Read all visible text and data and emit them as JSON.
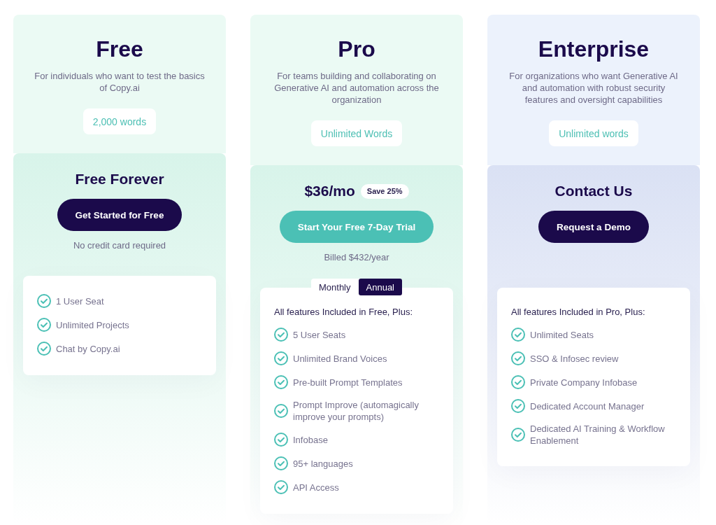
{
  "plans": [
    {
      "name": "Free",
      "description": "For individuals who want to test the basics of Copy.ai",
      "color": "#ebfaf4",
      "word_limit": "2,000 words",
      "offer": {
        "color": "#d8f4ea",
        "headline": "Free Forever",
        "cta": {
          "label": "Get Started for Free",
          "kind": "dark"
        },
        "note": "No credit card required"
      },
      "features": {
        "items": [
          "1 User Seat",
          "Unlimited Projects",
          "Chat by Copy.ai"
        ]
      }
    },
    {
      "name": "Pro",
      "description": "For teams building and collaborating on Generative AI and automation across the organization",
      "color": "#ebfaf4",
      "word_limit": "Unlimited Words",
      "offer": {
        "color": "#d8f4ea",
        "headline": "$36/mo",
        "badge": "Save 25%",
        "cta": {
          "label": "Start Your Free 7-Day Trial",
          "kind": "teal"
        },
        "note": "Billed $432/year",
        "billing_toggle": [
          {
            "label": "Monthly",
            "selected": false
          },
          {
            "label": "Annual",
            "selected": true
          }
        ]
      },
      "features": {
        "heading": "All features Included in Free, Plus:",
        "items": [
          "5 User Seats",
          "Unlimited Brand Voices",
          "Pre-built Prompt Templates",
          "Prompt Improve (automagically improve your prompts)",
          "Infobase",
          "95+ languages",
          "API Access"
        ]
      }
    },
    {
      "name": "Enterprise",
      "description": "For organizations who want Generative AI and automation with robust security features and oversight capabilities",
      "color": "#ecf2fc",
      "word_limit": "Unlimited words",
      "offer": {
        "color": "#dae1f4",
        "headline": "Contact Us",
        "cta": {
          "label": "Request a Demo",
          "kind": "dark"
        }
      },
      "features": {
        "heading": "All features Included in Pro, Plus:",
        "items": [
          "Unlimited Seats",
          "SSO & Infosec review",
          "Private Company Infobase",
          "Dedicated Account Manager",
          "Dedicated AI Training & Workflow Enablement"
        ]
      }
    }
  ]
}
